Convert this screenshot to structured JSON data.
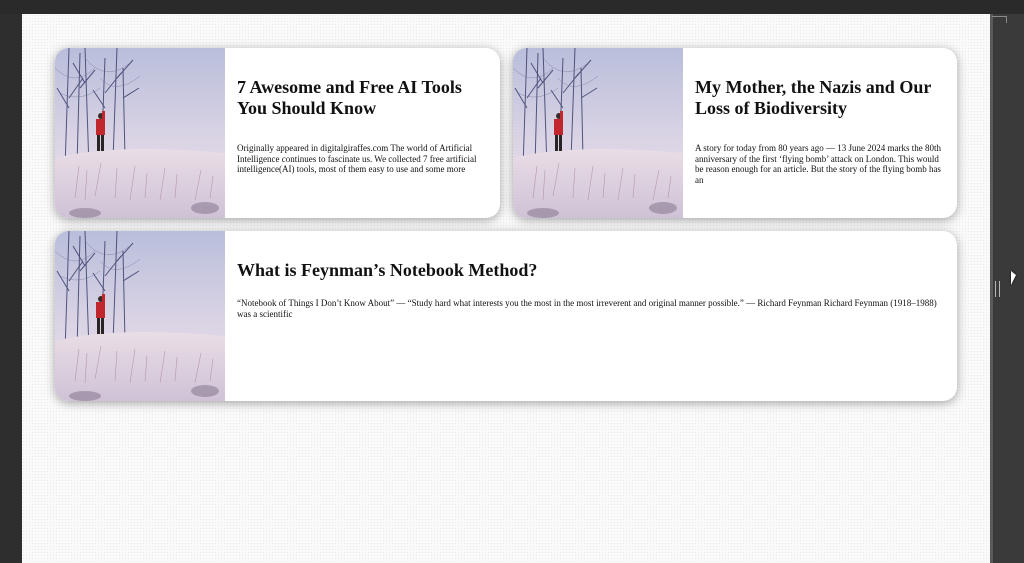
{
  "cards": [
    {
      "title": "7 Awesome and Free AI Tools You Should Know",
      "excerpt": "Originally appeared in digitalgiraffes.com The world of Artificial Intelligence continues to fascinate us. We collected 7 free artificial intelligence(AI) tools, most of them easy to use and some more",
      "image_icon": "snowy-landscape-person-red-jacket"
    },
    {
      "title": "My Mother, the Nazis and Our Loss of Biodiversity",
      "excerpt": "A story for today from 80 years ago — 13 June 2024 marks the 80th anniversary of the first ‘flying bomb’ attack on London. This would be reason enough for an article. But the story of the flying bomb has an",
      "image_icon": "snowy-landscape-person-red-jacket"
    },
    {
      "title": "What is Feynman’s Notebook Method?",
      "excerpt": "“Notebook of Things I Don’t Know About” — “Study hard what interests you the most in the most irreverent and original manner possible.” — Richard Feynman Richard Feynman (1918–1988) was a scientific",
      "image_icon": "snowy-landscape-person-red-jacket"
    }
  ],
  "colors": {
    "background": "#fafafa",
    "card": "#ffffff",
    "text": "#111111",
    "jacket": "#c0262c"
  }
}
